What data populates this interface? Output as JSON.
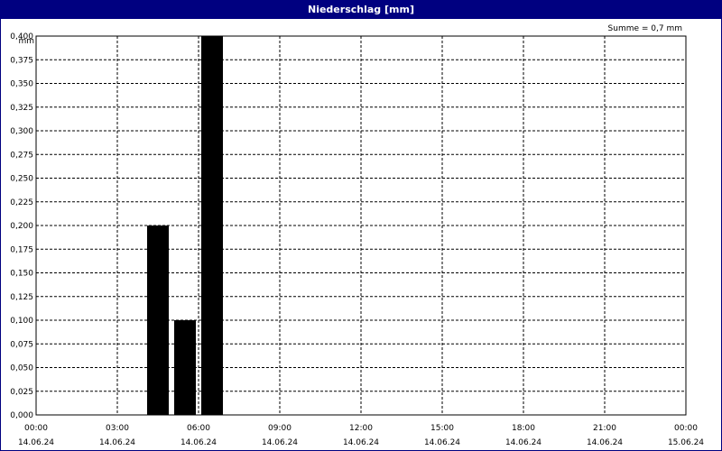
{
  "window": {
    "title": "Niederschlag [mm]"
  },
  "chart_data": {
    "type": "bar",
    "title": "Niederschlag [mm]",
    "ylabel": "mm",
    "summary": "Summe = 0,7 mm",
    "ylim": [
      0,
      0.4
    ],
    "y_ticks": [
      "0,000",
      "0,025",
      "0,050",
      "0,075",
      "0,100",
      "0,125",
      "0,150",
      "0,175",
      "0,200",
      "0,225",
      "0,250",
      "0,275",
      "0,300",
      "0,325",
      "0,350",
      "0,375",
      "0,400"
    ],
    "xlim_hours": [
      0,
      24
    ],
    "x_ticks": [
      {
        "time": "00:00",
        "date": "14.06.24"
      },
      {
        "time": "03:00",
        "date": "14.06.24"
      },
      {
        "time": "06:00",
        "date": "14.06.24"
      },
      {
        "time": "09:00",
        "date": "14.06.24"
      },
      {
        "time": "12:00",
        "date": "14.06.24"
      },
      {
        "time": "15:00",
        "date": "14.06.24"
      },
      {
        "time": "18:00",
        "date": "14.06.24"
      },
      {
        "time": "21:00",
        "date": "14.06.24"
      },
      {
        "time": "00:00",
        "date": "15.06.24"
      }
    ],
    "bars": [
      {
        "start": "14.06.24 04:00",
        "end": "14.06.24 05:00",
        "value": 0.2
      },
      {
        "start": "14.06.24 05:00",
        "end": "14.06.24 06:00",
        "value": 0.1
      },
      {
        "start": "14.06.24 06:00",
        "end": "14.06.24 07:00",
        "value": 0.4
      }
    ],
    "grid": true,
    "colors": {
      "bar": "#000000",
      "titlebar": "#000080"
    }
  }
}
